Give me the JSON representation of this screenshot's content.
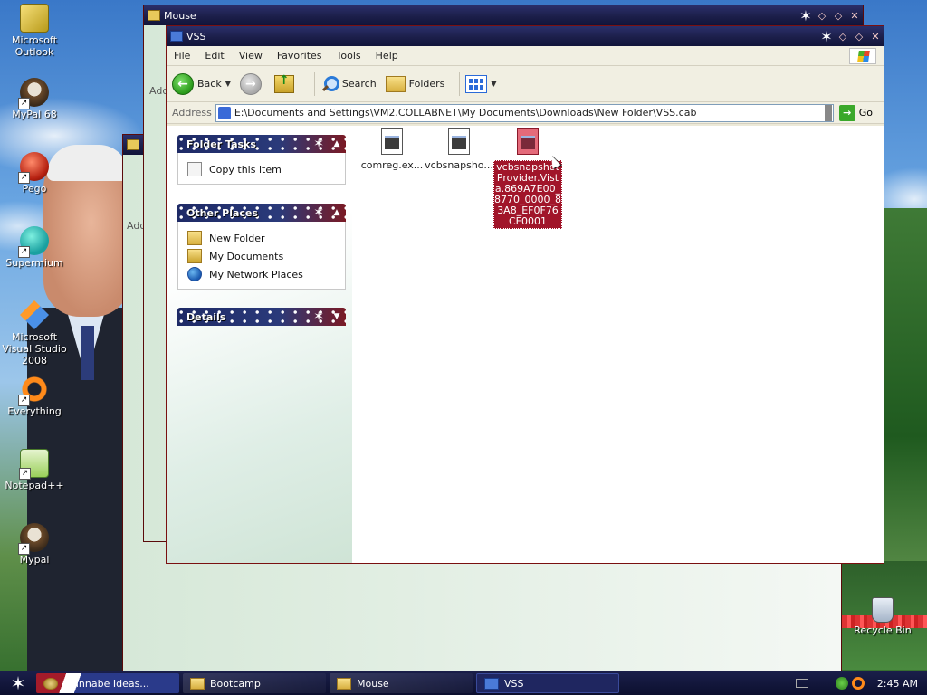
{
  "desktop": {
    "icons": [
      {
        "label": "Microsoft Outlook",
        "icon": "outlook-icon"
      },
      {
        "label": "MyPal 68",
        "icon": "mypal-icon"
      },
      {
        "label": "Pego",
        "icon": "pego-icon"
      },
      {
        "label": "Supermium",
        "icon": "supermium-icon"
      },
      {
        "label": "Microsoft Visual Studio 2008",
        "icon": "visual-studio-icon"
      },
      {
        "label": "Everything",
        "icon": "everything-icon"
      },
      {
        "label": "Notepad++",
        "icon": "notepad-plus-plus-icon"
      },
      {
        "label": "Mypal",
        "icon": "mypal-icon"
      },
      {
        "label": "Recycle Bin",
        "icon": "recycle-bin-icon"
      }
    ]
  },
  "background_windows": [
    {
      "title": "Mouse"
    },
    {
      "partial_address_label": "Add"
    },
    {
      "partial_address_label": "Add"
    }
  ],
  "window": {
    "title": "VSS",
    "menu": [
      "File",
      "Edit",
      "View",
      "Favorites",
      "Tools",
      "Help"
    ],
    "toolbar": {
      "back": "Back",
      "search": "Search",
      "folders": "Folders"
    },
    "address": {
      "label": "Address",
      "path": "E:\\Documents and Settings\\VM2.COLLABNET\\My Documents\\Downloads\\New Folder\\VSS.cab",
      "go": "Go"
    },
    "taskpane": {
      "folder_tasks": {
        "title": "Folder Tasks",
        "items": [
          "Copy this item"
        ]
      },
      "other_places": {
        "title": "Other Places",
        "items": [
          "New Folder",
          "My Documents",
          "My Network Places"
        ]
      },
      "details": {
        "title": "Details"
      }
    },
    "files": [
      {
        "name": "comreg.ex..."
      },
      {
        "name": "vcbsnapsho..."
      },
      {
        "name": "vcbsnapshotProvider.Vista.869A7E00_8770_0000_83A8_EF0F76CF0001",
        "display": "vcbsnapshotProvider.Vista.869A7E00_8770_0000_83A8_EF0F76CF0001",
        "selected": true
      }
    ]
  },
  "taskbar": {
    "tasks": [
      {
        "label": "Wannabe Ideas..."
      },
      {
        "label": "Bootcamp"
      },
      {
        "label": "Mouse"
      },
      {
        "label": "VSS",
        "active": true
      }
    ],
    "clock": "2:45 AM"
  },
  "colors": {
    "titlebar": "#1c1f4a",
    "selection": "#a1152a",
    "taskpane_header": "#2a3a7a"
  }
}
